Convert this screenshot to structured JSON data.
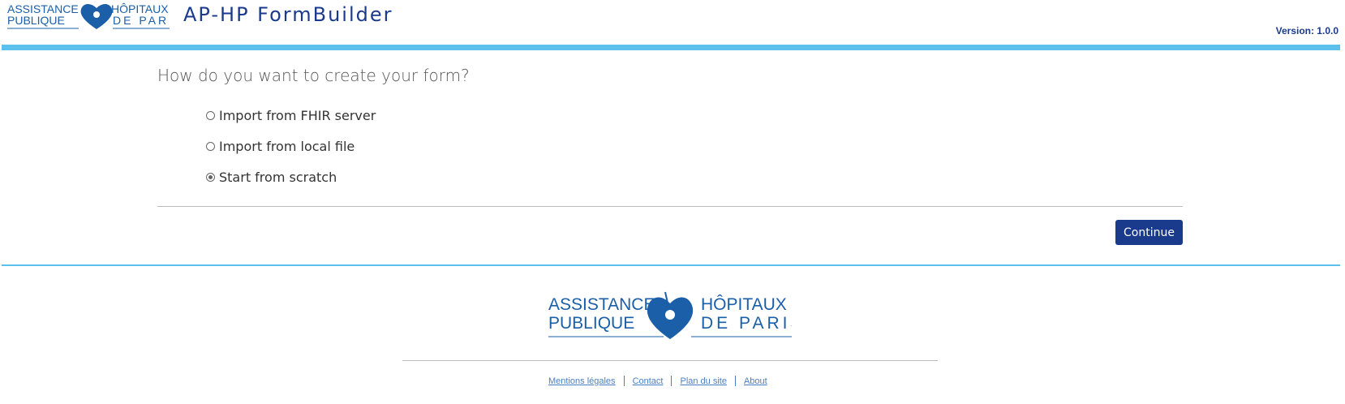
{
  "header": {
    "logo": {
      "line1_left": "ASSISTANCE",
      "line2_left": "PUBLIQUE",
      "line1_right": "HÔPITAUX",
      "line2_right": "DE PARIS"
    },
    "app_title": "AP-HP FormBuilder",
    "version": "Version: 1.0.0"
  },
  "main": {
    "question": "How do you want to create your form?",
    "options": [
      {
        "label": "Import from FHIR server",
        "checked": false
      },
      {
        "label": "Import from local file",
        "checked": false
      },
      {
        "label": "Start from scratch",
        "checked": true
      }
    ],
    "continue_label": "Continue"
  },
  "footer": {
    "logo": {
      "line1_left": "ASSISTANCE",
      "line2_left": "PUBLIQUE",
      "line1_right": "HÔPITAUX",
      "line2_right": "DE PARIS"
    },
    "links": [
      "Mentions légales",
      "Contact",
      "Plan du site",
      "About"
    ]
  },
  "colors": {
    "brand_blue": "#1a3a8c",
    "accent_cyan": "#5bc0eb",
    "logo_blue": "#1a5fa8"
  }
}
